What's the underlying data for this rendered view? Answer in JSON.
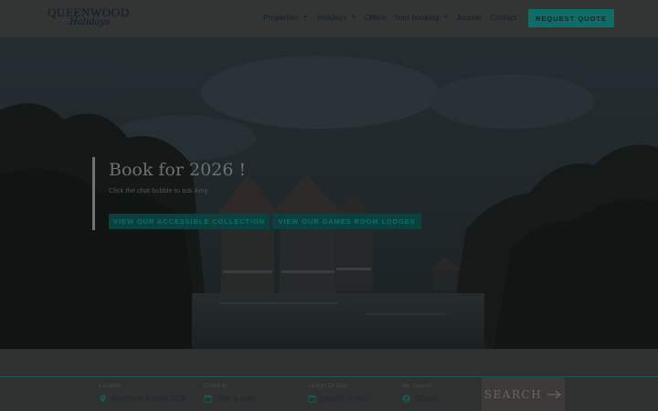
{
  "brand": {
    "name": "QUEENWOOD",
    "tagline": "Holidays"
  },
  "nav": {
    "items": [
      {
        "label": "Properties",
        "dropdown": true
      },
      {
        "label": "Holidays",
        "dropdown": true
      },
      {
        "label": "Offers",
        "dropdown": false
      },
      {
        "label": "Your booking",
        "dropdown": true
      },
      {
        "label": "Journal",
        "dropdown": false
      },
      {
        "label": "Contact",
        "dropdown": false
      }
    ],
    "quote_label": "REQUEST QUOTE"
  },
  "hero": {
    "title": "Book for 2026 !",
    "subtitle": "Click the chat bubble to ask Amy",
    "buttons": [
      {
        "label": "VIEW OUR ACCESSIBLE COLLECTION"
      },
      {
        "label": "VIEW OUR GAMES ROOM LODGES"
      }
    ]
  },
  "search": {
    "location": {
      "label": "Location",
      "value": "Retallack Resort CORN"
    },
    "checkin": {
      "label": "Check in",
      "placeholder": "Pick a date"
    },
    "length": {
      "label": "Length Of Stay",
      "placeholder": "Length of stay"
    },
    "guests": {
      "label": "No. Guests",
      "placeholder": "Guests"
    },
    "button_label": "SEARCH"
  },
  "colors": {
    "accent": "#106c66",
    "overlay": "#2f3131",
    "text_dark": "#121e2c"
  }
}
